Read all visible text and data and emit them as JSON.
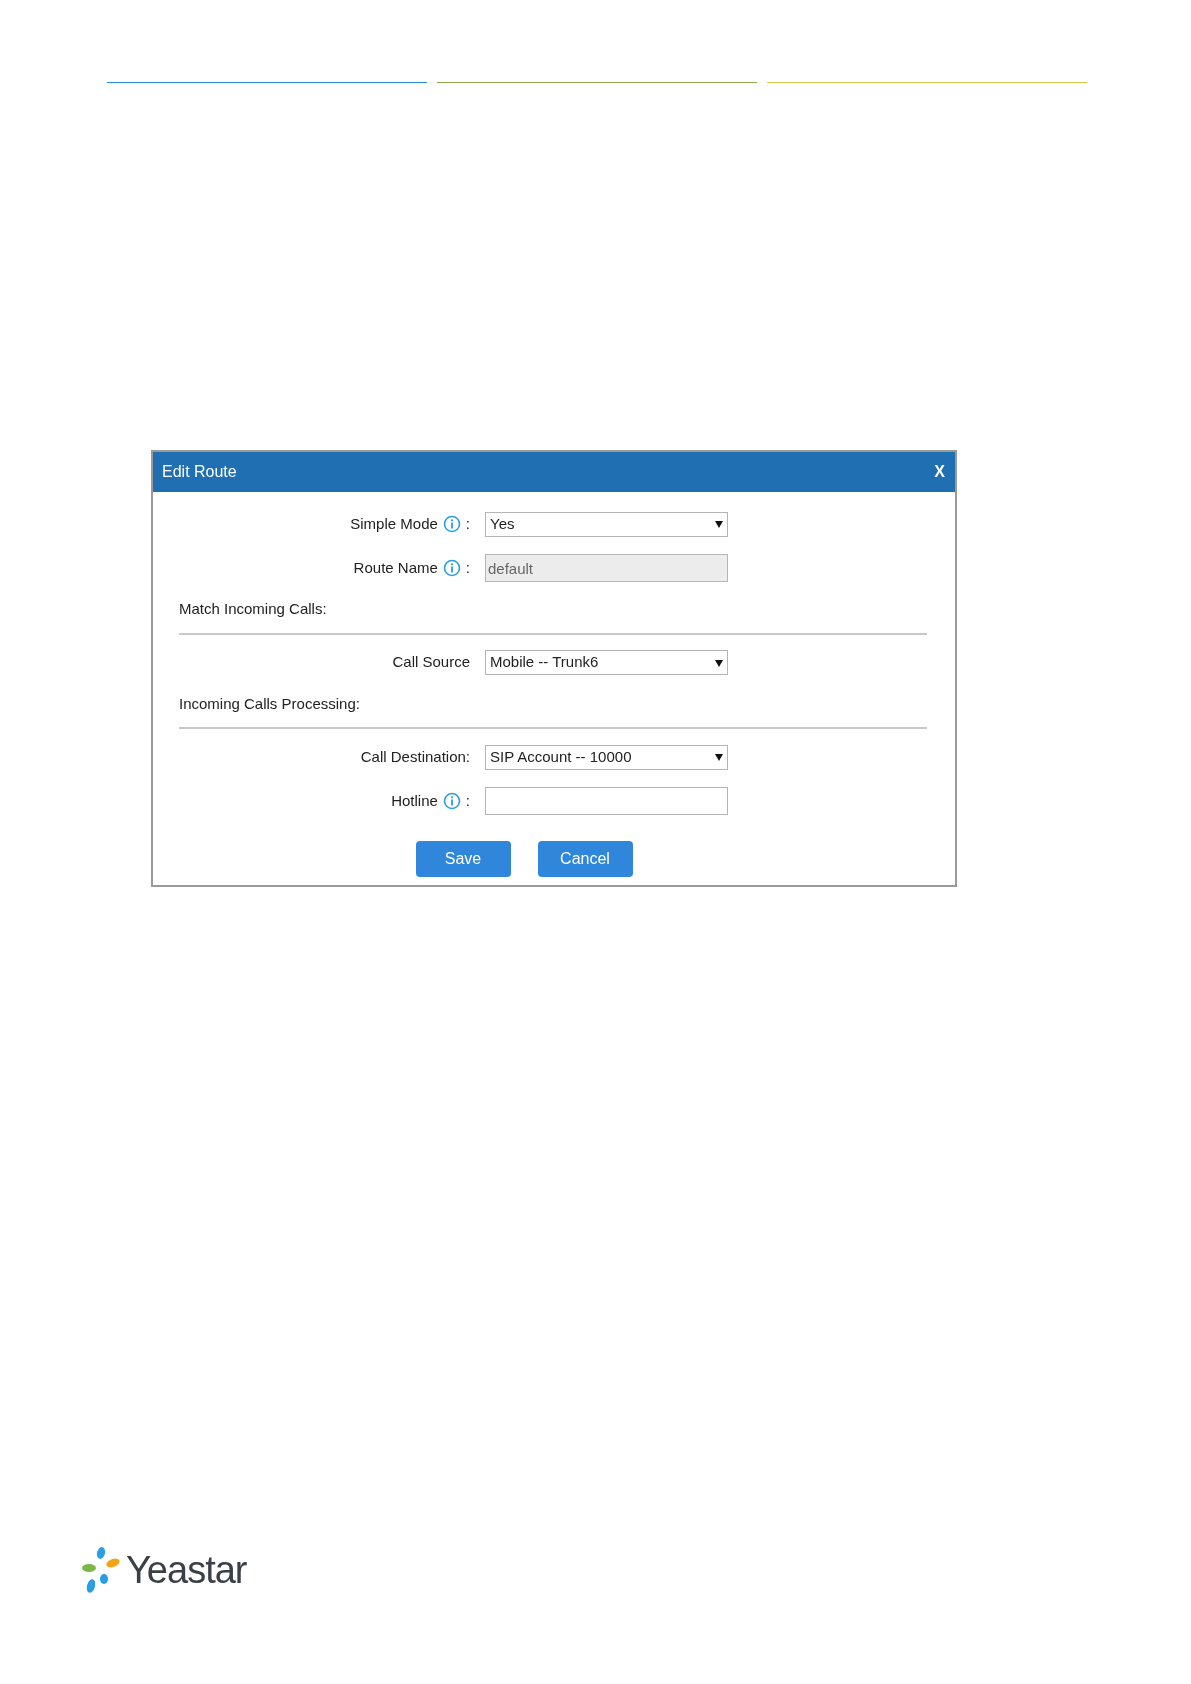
{
  "dialog": {
    "title": "Edit Route",
    "close": "X",
    "rows": [
      {
        "kind": "select",
        "label": "Simple Mode",
        "info": true,
        "colon": ":",
        "value": "Yes"
      },
      {
        "kind": "input",
        "label": "Route Name",
        "info": true,
        "colon": ":",
        "value": "default",
        "disabled": true
      },
      {
        "kind": "section",
        "label": "Match Incoming Calls:"
      },
      {
        "kind": "select",
        "label": "Call Source",
        "info": false,
        "value": "Mobile -- Trunk6"
      },
      {
        "kind": "section",
        "label": "Incoming Calls Processing:"
      },
      {
        "kind": "select",
        "label": "Call Destination:",
        "info": false,
        "value": "SIP Account -- 10000"
      },
      {
        "kind": "input",
        "label": "Hotline",
        "info": true,
        "colon": ":",
        "value": "",
        "disabled": false
      }
    ],
    "buttons": [
      "Save",
      "Cancel"
    ]
  },
  "footer": {
    "logo_text": "Yeastar"
  }
}
